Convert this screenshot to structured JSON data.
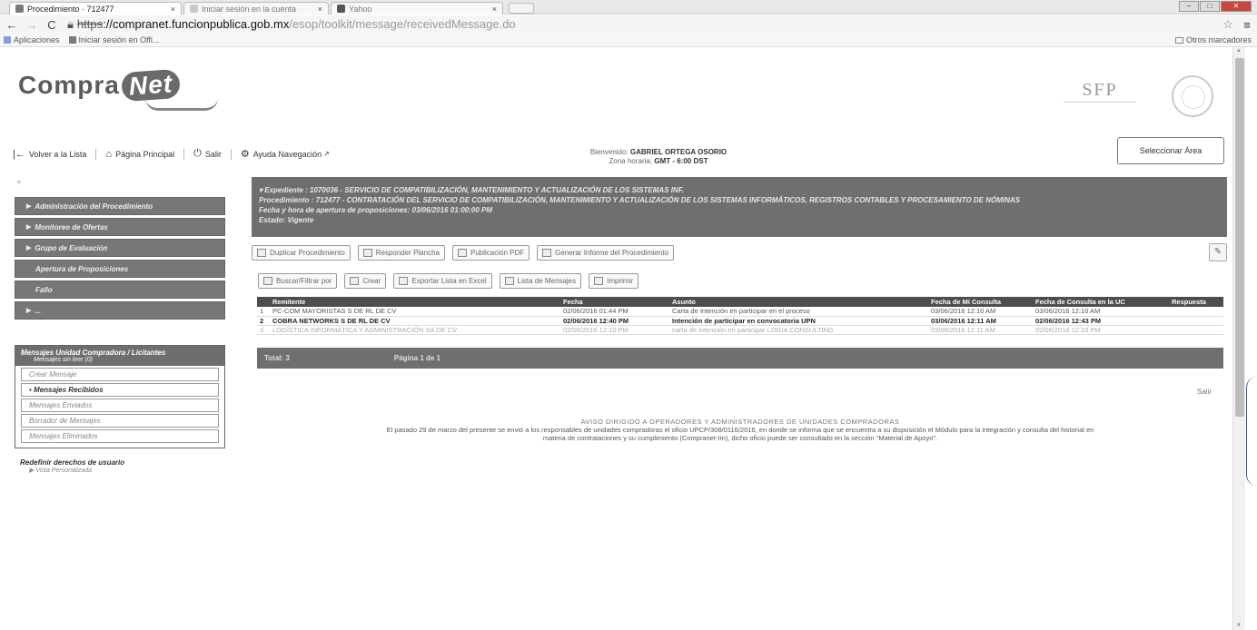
{
  "browser": {
    "tabs": [
      {
        "label": "Procedimiento · 712477",
        "close": "×"
      },
      {
        "label": "Iniciar sesión en la cuenta",
        "close": "×"
      },
      {
        "label": "Yahoo",
        "close": "×"
      }
    ],
    "url_scheme": "https",
    "url_host": "://compranet.funcionpublica.gob.mx",
    "url_path": "/esop/toolkit/message/receivedMessage.do",
    "bookmarks": {
      "apps": "Aplicaciones",
      "office": "Iniciar sesión en Offi...",
      "other": "Otros marcadores"
    }
  },
  "header": {
    "logo_left": "Compra",
    "logo_right": "Net",
    "sfp": "SFP"
  },
  "topnav": {
    "back": "Volver a la Lista",
    "home": "Página Principal",
    "exit": "Salir",
    "help": "Ayuda Navegación"
  },
  "welcome": {
    "line1_label": "Bienvenido:",
    "line1_value": "GABRIEL ORTEGA OSORIO",
    "line2_label": "Zona horaria:",
    "line2_value": "GMT - 6:00 DST"
  },
  "area_button": "Seleccionar Área",
  "sidebar": {
    "plus": "+",
    "items": [
      {
        "label": "Administración del Procedimiento",
        "arrow": "▶"
      },
      {
        "label": "Monitoreo de Ofertas",
        "arrow": "▶"
      },
      {
        "label": "Grupo de Evaluación",
        "arrow": "▶"
      },
      {
        "label": "Apertura de Proposiciones",
        "arrow": ""
      },
      {
        "label": "Fallo",
        "arrow": ""
      },
      {
        "label": "...",
        "arrow": "▶"
      }
    ],
    "messages": {
      "title": "Mensajes Unidad Compradora / Licitantes",
      "unread": "Mensajes sin leer (0)",
      "options": [
        {
          "label": "Crear Mensaje"
        },
        {
          "label": "▪ Mensajes Recibidos"
        },
        {
          "label": "Mensajes Enviados"
        },
        {
          "label": "Borrador de Mensajes"
        },
        {
          "label": "Mensajes Eliminados"
        }
      ]
    },
    "redefine": {
      "title": "Redefinir derechos de usuario",
      "sub": "▶ Vista Personalizada"
    }
  },
  "expediente": {
    "line1": "▾ Expediente : 1070036 - SERVICIO DE COMPATIBILIZACIÓN, MANTENIMIENTO Y ACTUALIZACIÓN DE LOS SISTEMAS INF.",
    "line2": "Procedimiento : 712477 - CONTRATACIÓN DEL SERVICIO DE COMPATIBILIZACIÓN, MANTENIMIENTO Y ACTUALIZACIÓN DE LOS SISTEMAS INFORMÁTICOS, REGISTROS CONTABLES Y PROCESAMIENTO DE NÓMINAS",
    "line3": "Fecha y hora de apertura de proposiciones: 03/06/2016 01:00:00 PM",
    "line4": "Estado: Vigente"
  },
  "toolbar1": [
    {
      "label": "Duplicar Procedimiento"
    },
    {
      "label": "Responder Plancha"
    },
    {
      "label": "Publicación PDF"
    },
    {
      "label": "Generar Informe del Procedimiento"
    }
  ],
  "toolbar2": [
    {
      "label": "Buscar/Filtrar por"
    },
    {
      "label": "Crear"
    },
    {
      "label": "Exportar Lista en Excel"
    },
    {
      "label": "Lista de Mensajes"
    },
    {
      "label": "Imprimir"
    }
  ],
  "table": {
    "headers": [
      "",
      "Remitente",
      "Fecha",
      "Asunto",
      "Fecha de Mi Consulta",
      "Fecha de Consulta en la UC",
      "Respuesta"
    ],
    "rows": [
      [
        "1",
        "PC-COM MAYORISTAS S DE RL DE CV",
        "02/06/2016 01:44 PM",
        "Carta de Intención en participar en el proceso",
        "03/06/2016 12:10 AM",
        "03/06/2016 12:10 AM",
        ""
      ],
      [
        "2",
        "COBRA NETWORKS S DE RL DE CV",
        "02/06/2016 12:40 PM",
        "Intención de participar en convocatoria UPN",
        "03/06/2016 12:11 AM",
        "02/06/2016 12:43 PM",
        ""
      ],
      [
        "3",
        "LOGÍSTICA INFORMÁTICA Y ADMINISTRACIÓN SA DE CV",
        "02/06/2016 12:10 PM",
        "carta de intención en participar LOGIA CONSULTING",
        "03/06/2016 12:11 AM",
        "02/06/2016 12:33 PM",
        ""
      ]
    ],
    "total": "Total: 3",
    "page": "Página 1 de 1"
  },
  "salir": "Salir",
  "aviso": {
    "title": "AVISO DIRIGIDO A OPERADORES Y ADMINISTRADORES DE UNIDADES COMPRADORAS",
    "body1": "El pasado 29 de marzo del presente se envió a los responsables de unidades compradoras el oficio UPCP/308/0116/2016, en donde se informa que se encuentra a su disposición el Módulo para la integración y consulta del historial en",
    "body2": "materia de contrataciones y su cumplimiento (Compranet-Im), dicho oficio puede ser consultado en la sección \"Material de Apoyo\"."
  },
  "colors": {
    "panel": "#6f6f6f",
    "table_header": "#4e4e4e"
  }
}
